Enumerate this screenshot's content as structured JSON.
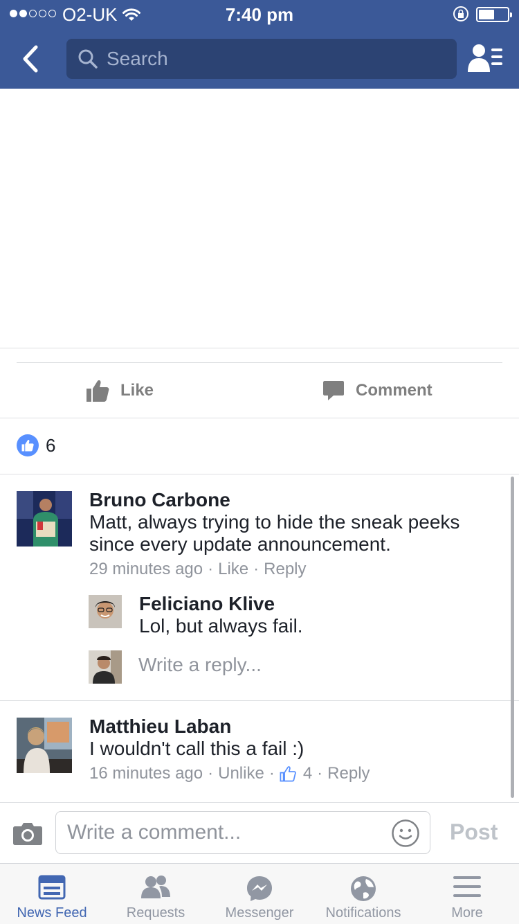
{
  "status_bar": {
    "carrier": "O2-UK",
    "time": "7:40 pm"
  },
  "header": {
    "search_placeholder": "Search"
  },
  "post_actions": {
    "like_label": "Like",
    "comment_label": "Comment"
  },
  "reactions": {
    "like_count": "6"
  },
  "comments": [
    {
      "author": "Bruno Carbone",
      "text_line1": "Matt, always trying to hide the sneak peeks",
      "text_line2": "since every update announcement.",
      "time": "29 minutes ago",
      "like_label": "Like",
      "reply_label": "Reply",
      "replies": [
        {
          "author": "Feliciano Klive",
          "text": "Lol, but always fail."
        }
      ],
      "reply_placeholder": "Write a reply..."
    },
    {
      "author": "Matthieu Laban",
      "text": "I wouldn't call this a fail :)",
      "time": "16 minutes ago",
      "like_label": "Unlike",
      "like_count": "4",
      "reply_label": "Reply"
    }
  ],
  "composer": {
    "placeholder": "Write a comment...",
    "post_label": "Post"
  },
  "tabs": [
    {
      "label": "News Feed",
      "icon": "news-feed-icon",
      "active": true
    },
    {
      "label": "Requests",
      "icon": "requests-icon",
      "active": false
    },
    {
      "label": "Messenger",
      "icon": "messenger-icon",
      "active": false
    },
    {
      "label": "Notifications",
      "icon": "globe-icon",
      "active": false
    },
    {
      "label": "More",
      "icon": "menu-icon",
      "active": false
    }
  ],
  "colors": {
    "brand": "#3b5998",
    "search_bg": "#2c4373",
    "like_blue": "#5890ff",
    "active_tab": "#4267b2",
    "meta_gray": "#90949c"
  }
}
